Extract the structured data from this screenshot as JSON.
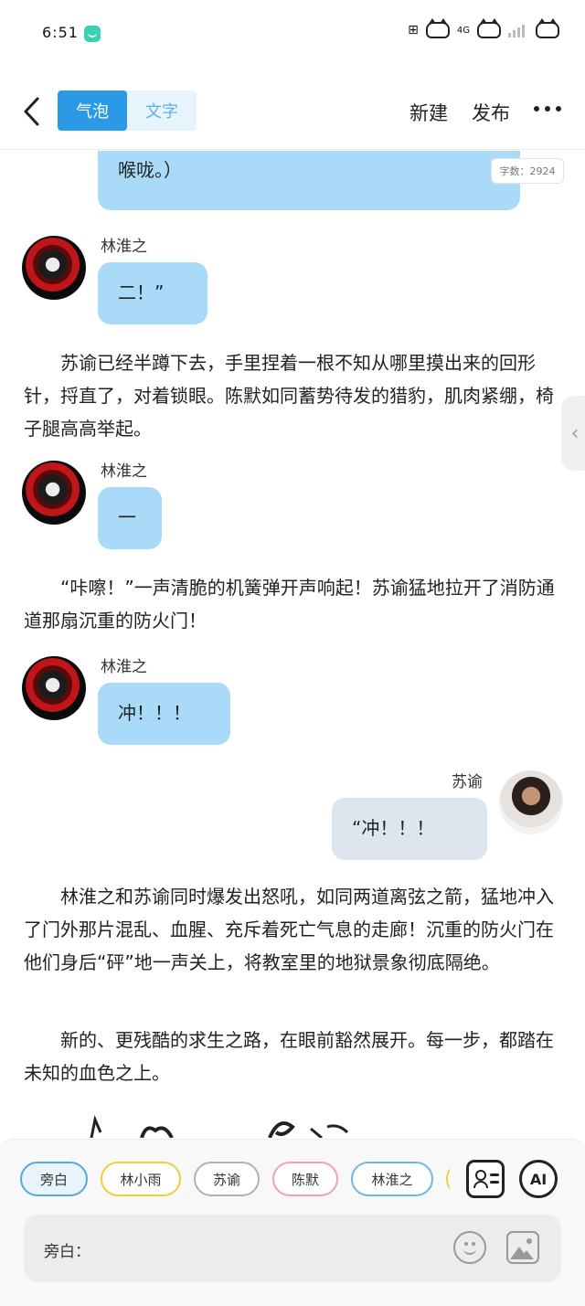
{
  "status_bar": {
    "time": "6:51",
    "network_label": "4G",
    "icons": [
      "app-icon",
      "cat-icon",
      "signal-icon",
      "battery-cat-icon"
    ]
  },
  "header": {
    "tabs": [
      {
        "label": "气泡",
        "active": true
      },
      {
        "label": "文字",
        "active": false
      }
    ],
    "new_label": "新建",
    "publish_label": "发布",
    "more_icon": "more-icon"
  },
  "word_count": "字数：2924",
  "content": {
    "top_bubble": {
      "text": "二……（他盯着后门的方向，心脏几乎要跳出喉咙。）"
    },
    "messages": [
      {
        "speaker": "林淮之",
        "text": "二！”"
      },
      {
        "speaker": "林淮之",
        "text": "一"
      },
      {
        "speaker": "林淮之",
        "text": "冲！！！"
      },
      {
        "speaker": "苏谕",
        "text": "“冲！！！"
      }
    ],
    "paragraphs": [
      "苏谕已经半蹲下去，手里捏着一根不知从哪里摸出来的回形针，捋直了，对着锁眼。陈默如同蓄势待发的猎豹，肌肉紧绷，椅子腿高高举起。",
      "“咔嚓！”一声清脆的机簧弹开声响起！苏谕猛地拉开了消防通道那扇沉重的防火门！",
      "林淮之和苏谕同时爆发出怒吼，如同两道离弦之箭，猛地冲入了门外那片混乱、血腥、充斥着死亡气息的走廊！沉重的防火门在他们身后“砰”地一声关上，将教室里的地狱景象彻底隔绝。",
      "新的、更残酷的求生之路，在眼前豁然展开。每一步，都踏在未知的血色之上。"
    ]
  },
  "bottom_panel": {
    "roles": [
      {
        "label": "旁白",
        "color": "#58a8e0",
        "selected": true
      },
      {
        "label": "林小雨",
        "color": "#f2cc3f",
        "selected": false
      },
      {
        "label": "苏谕",
        "color": "#a8b4be",
        "selected": false
      },
      {
        "label": "陈默",
        "color": "#f2a1b0",
        "selected": false
      },
      {
        "label": "林淮之",
        "color": "#6fb6e6",
        "selected": false
      },
      {
        "label": "",
        "color": "#f2cc3f",
        "selected": false
      }
    ],
    "roles_button_icon": "role-list-icon",
    "ai_label": "AI",
    "input_label": "旁白："
  },
  "colors": {
    "accent": "#2a9ae6",
    "bubble_left": "#a9dbf8",
    "bubble_right": "#dde6ef"
  }
}
